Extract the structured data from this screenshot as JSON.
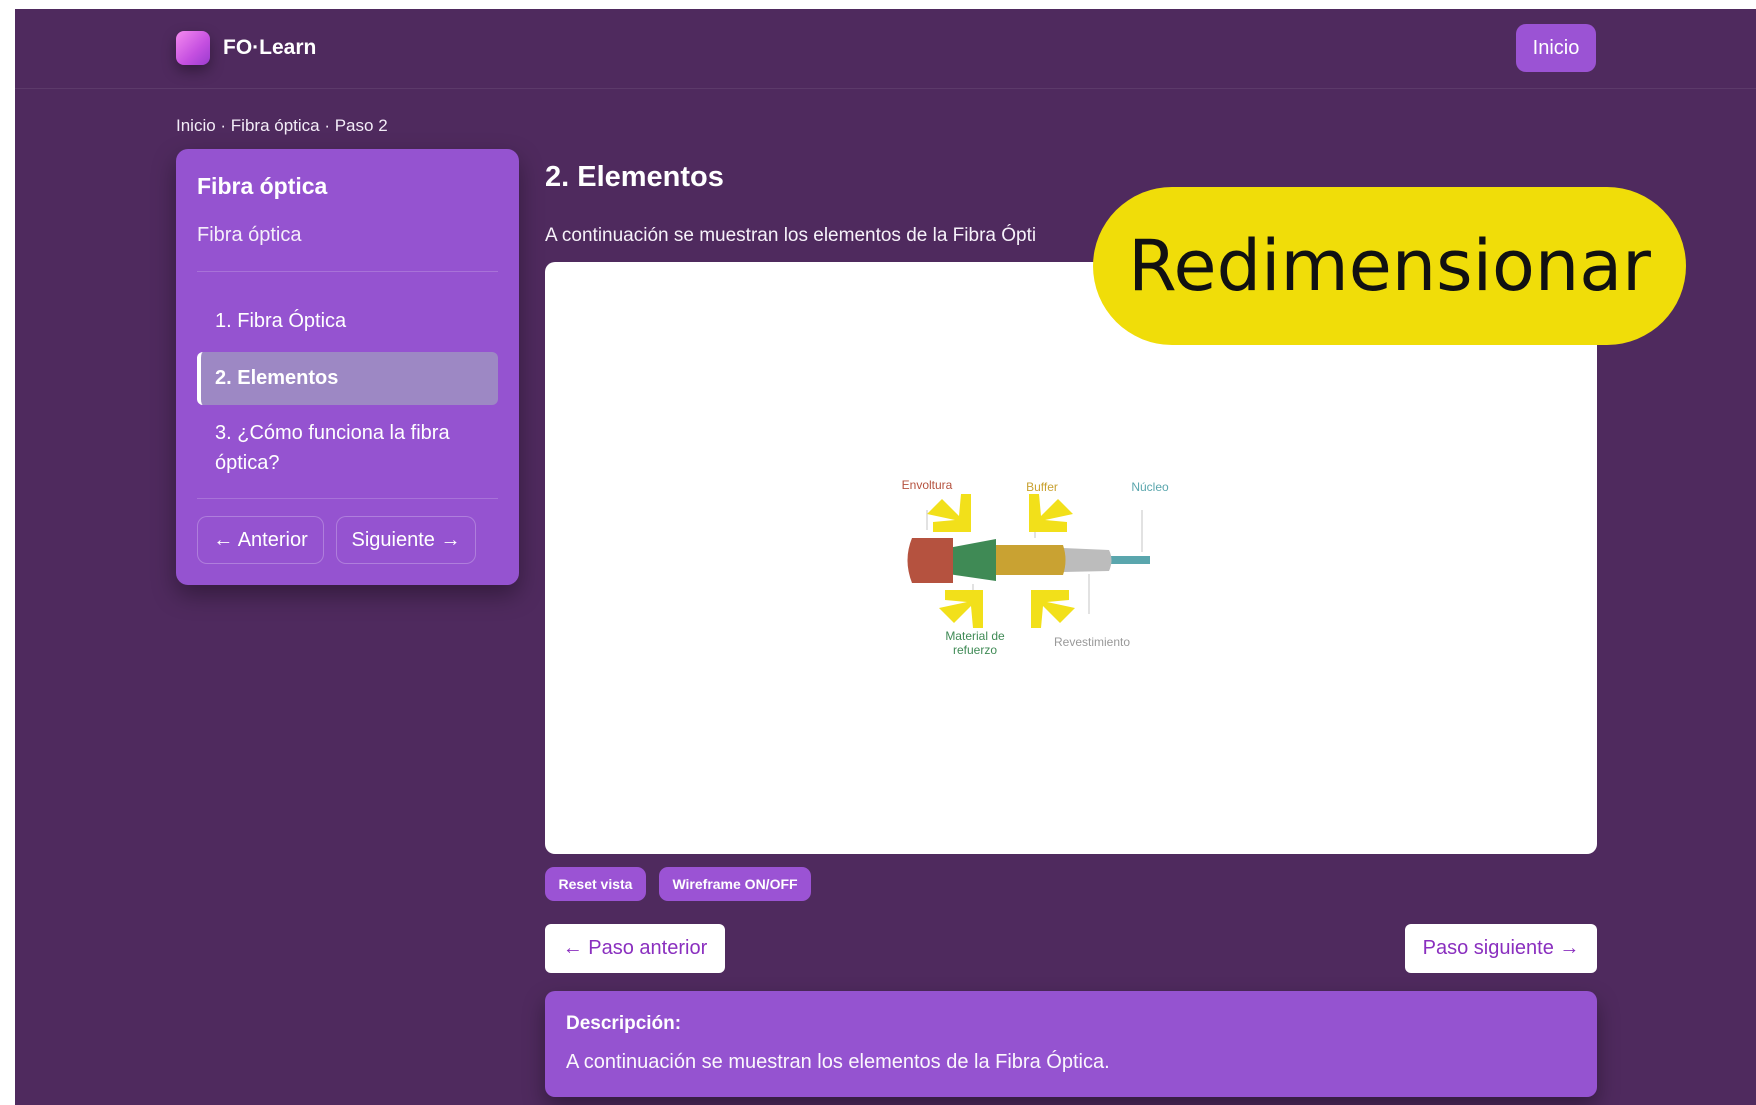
{
  "header": {
    "brand": "FO·Learn",
    "home_button": "Inicio"
  },
  "breadcrumb": "Inicio · Fibra óptica · Paso 2",
  "sidebar": {
    "title": "Fibra óptica",
    "subtitle": "Fibra óptica",
    "items": [
      {
        "label": "1. Fibra Óptica",
        "active": false
      },
      {
        "label": "2. Elementos",
        "active": true
      },
      {
        "label": "3. ¿Cómo funciona la fibra óptica?",
        "active": false
      }
    ],
    "prev_button": "← Anterior",
    "next_button": "Siguiente →"
  },
  "main": {
    "title": "2. Elementos",
    "intro": "A continuación se muestran los elementos de la Fibra Ópti",
    "viewer": {
      "labels": {
        "envoltura": "Envoltura",
        "buffer": "Buffer",
        "nucleo": "Núcleo",
        "material_line1": "Material de",
        "material_line2": "refuerzo",
        "revestimiento": "Revestimiento"
      },
      "colors": {
        "envoltura": "#b5523f",
        "material": "#3f8a55",
        "buffer": "#c9a232",
        "revestimiento": "#bcbcbc",
        "nucleo": "#5aa6ad",
        "arrows": "#f2e01a"
      }
    },
    "tools": {
      "reset": "Reset vista",
      "wireframe": "Wireframe ON/OFF"
    },
    "nav": {
      "prev": "← Paso anterior",
      "next": "Paso siguiente →"
    },
    "description": {
      "title": "Descripción:",
      "text": "A continuación se muestran los elementos de la Fibra Óptica."
    }
  },
  "overlay": {
    "label": "Redimensionar"
  }
}
